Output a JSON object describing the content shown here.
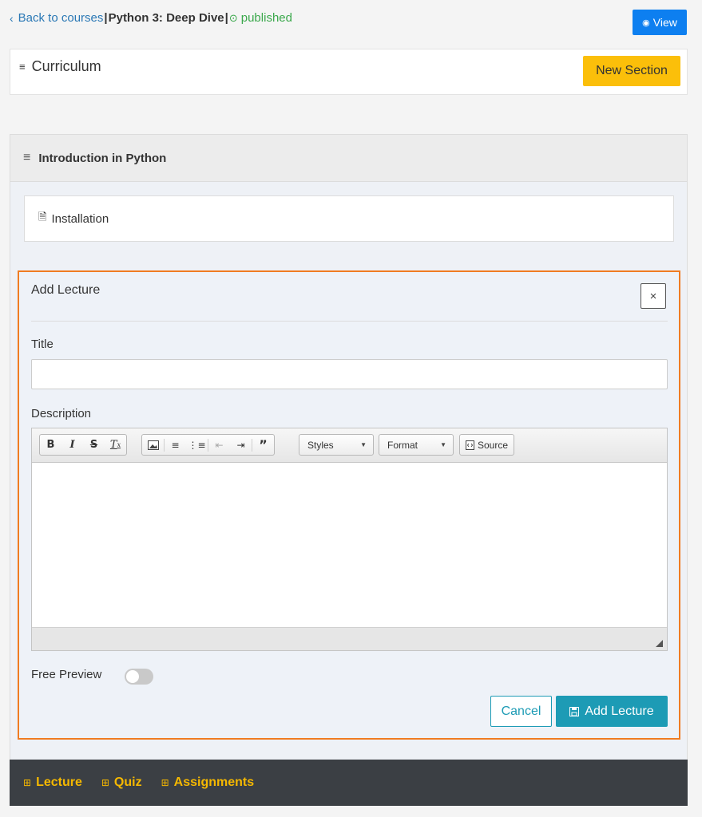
{
  "nav": {
    "back_icon": "chevron-left-icon",
    "back_label": "Back to courses",
    "separator": "|",
    "course_title": "Python 3: Deep Dive",
    "status_icon": "check-circle-icon",
    "status": "published",
    "view_label": "View"
  },
  "curriculum": {
    "title": "Curriculum",
    "new_section_label": "New Section"
  },
  "section": {
    "title": "Introduction in Python",
    "lectures": [
      {
        "title": "Installation",
        "icon": "document-icon"
      }
    ]
  },
  "add_lecture": {
    "heading": "Add Lecture",
    "close_label": "×",
    "title_label": "Title",
    "title_value": "",
    "description_label": "Description",
    "styles_label": "Styles",
    "format_label": "Format",
    "source_label": "Source",
    "free_preview_label": "Free Preview",
    "free_preview_on": false,
    "cancel_label": "Cancel",
    "submit_label": "Add Lecture"
  },
  "bottom_bar": {
    "items": [
      {
        "label": "Lecture"
      },
      {
        "label": "Quiz"
      },
      {
        "label": "Assignments"
      }
    ]
  },
  "colors": {
    "link": "#2a78b5",
    "published": "#3aa84b",
    "primary": "#0d7ff0",
    "warning": "#fbbf0a",
    "accent": "#1d9bb5",
    "highlight": "#f07c22",
    "bottom_bar": "#3b3f44"
  }
}
